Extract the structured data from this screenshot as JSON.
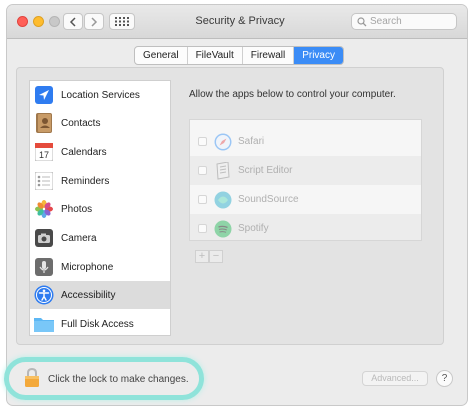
{
  "window": {
    "title": "Security & Privacy",
    "search_placeholder": "Search"
  },
  "tabs": [
    {
      "label": "General",
      "active": false
    },
    {
      "label": "FileVault",
      "active": false
    },
    {
      "label": "Firewall",
      "active": false
    },
    {
      "label": "Privacy",
      "active": true
    }
  ],
  "sidebar": {
    "selected": "Accessibility",
    "items": [
      {
        "label": "Location Services",
        "icon": "location-arrow-icon"
      },
      {
        "label": "Contacts",
        "icon": "contacts-book-icon"
      },
      {
        "label": "Calendars",
        "icon": "calendar-icon",
        "icon_text": "17"
      },
      {
        "label": "Reminders",
        "icon": "reminders-list-icon"
      },
      {
        "label": "Photos",
        "icon": "photos-flower-icon"
      },
      {
        "label": "Camera",
        "icon": "camera-icon"
      },
      {
        "label": "Microphone",
        "icon": "microphone-icon"
      },
      {
        "label": "Accessibility",
        "icon": "accessibility-person-icon"
      },
      {
        "label": "Full Disk Access",
        "icon": "folder-icon"
      }
    ]
  },
  "main": {
    "prompt": "Allow the apps below to control your computer.",
    "apps": [
      {
        "name": "Safari",
        "icon": "safari-compass-icon",
        "checked": false
      },
      {
        "name": "Script Editor",
        "icon": "script-editor-icon",
        "checked": false
      },
      {
        "name": "SoundSource",
        "icon": "soundsource-icon",
        "checked": false
      },
      {
        "name": "Spotify",
        "icon": "spotify-icon",
        "checked": false
      }
    ],
    "add_label": "+",
    "remove_label": "−"
  },
  "footer": {
    "lock_text": "Click the lock to make changes.",
    "advanced_label": "Advanced...",
    "help_label": "?"
  },
  "colors": {
    "accent": "#3b8cf6",
    "highlight": "#8fe3da"
  }
}
